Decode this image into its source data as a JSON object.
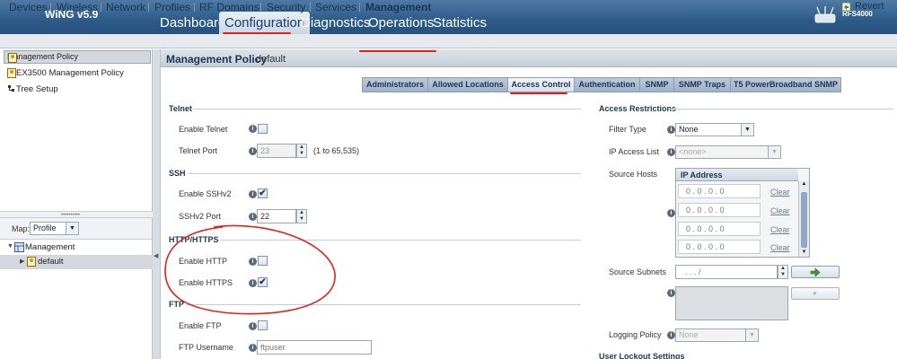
{
  "app": {
    "brand": "WiNG v5.9",
    "device": "RFS4000"
  },
  "main_tabs": [
    "Dashboard",
    "Configuration",
    "Diagnostics",
    "Operations",
    "Statistics"
  ],
  "sub_nav": [
    "Devices",
    "Wireless",
    "Network",
    "Profiles",
    "RF Domains",
    "Security",
    "Services",
    "Management"
  ],
  "revert_label": "Revert",
  "tree": {
    "items": [
      "Management Policy",
      "EX3500 Management Policy",
      "Tree Setup"
    ]
  },
  "map": {
    "label": "Map:",
    "value": "Profile"
  },
  "lower_tree": {
    "root": "Management",
    "child": "default"
  },
  "header": {
    "title": "Management Policy",
    "subtitle": "default"
  },
  "policy_tabs": [
    "Administrators",
    "Allowed Locations",
    "Access Control",
    "Authentication",
    "SNMP",
    "SNMP Traps",
    "T5 PowerBroadband SNMP"
  ],
  "telnet": {
    "section": "Telnet",
    "enable_label": "Enable Telnet",
    "port_label": "Telnet Port",
    "port_value": "23",
    "port_range": "(1 to 65,535)"
  },
  "ssh": {
    "section": "SSH",
    "enable_label": "Enable SSHv2",
    "port_label": "SSHv2 Port",
    "port_value": "22"
  },
  "http": {
    "section": "HTTP/HTTPS",
    "http_label": "Enable HTTP",
    "https_label": "Enable HTTPS"
  },
  "ftp": {
    "section": "FTP",
    "enable_label": "Enable FTP",
    "user_label": "FTP Username",
    "user_placeholder": "ftpuser"
  },
  "access": {
    "section": "Access Restrictions",
    "filter_label": "Filter Type",
    "filter_value": "None",
    "ipacl_label": "IP Access List",
    "ipacl_value": "<none>",
    "hosts_label": "Source Hosts",
    "hosts_col": "IP Address",
    "hosts": [
      "0 . 0 . 0 . 0",
      "0 . 0 . 0 . 0",
      "0 . 0 . 0 . 0",
      "0 . 0 . 0 . 0"
    ],
    "clear_label": "Clear",
    "subnets_label": "Source Subnets",
    "subnet_value": ". . . /",
    "logging_label": "Logging Policy",
    "logging_value": "None",
    "lockout_section": "User Lockout Settings"
  },
  "colors": {
    "topbar": "#2d5b88",
    "annotation": "#e2231a"
  }
}
